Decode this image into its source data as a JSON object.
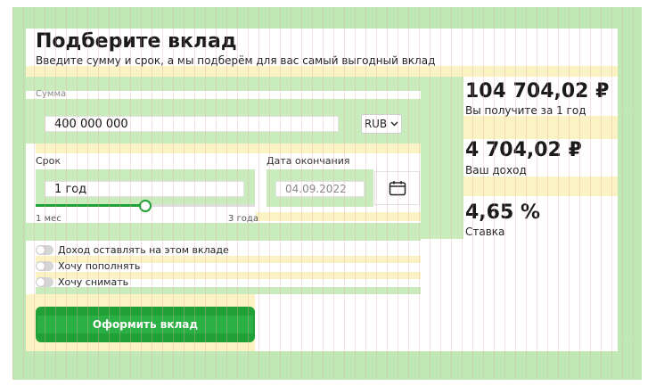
{
  "header": {
    "title": "Подберите вклад",
    "subtitle": "Введите сумму и срок, а мы подберём для вас самый выгодный вклад"
  },
  "amount": {
    "label": "Сумма",
    "value": "400 000 000",
    "currency": "RUB"
  },
  "term": {
    "label": "Срок",
    "value": "1 год",
    "slider_min_label": "1 мес",
    "slider_max_label": "3 года",
    "slider_fraction": 0.5
  },
  "end_date": {
    "label": "Дата окончания",
    "value": "04.09.2022"
  },
  "options": [
    {
      "label": "Доход оставлять на этом вкладе",
      "checked": false
    },
    {
      "label": "Хочу пополнять",
      "checked": false
    },
    {
      "label": "Хочу снимать",
      "checked": false
    }
  ],
  "submit": {
    "label": "Оформить вклад"
  },
  "results": {
    "total_value": "104 704,02 ₽",
    "total_caption": "Вы получите за 1 год",
    "income_value": "4 704,02 ₽",
    "income_caption": "Ваш доход",
    "rate_value": "4,65 %",
    "rate_caption": "Ставка"
  },
  "colors": {
    "accent": "#21a038",
    "overlay_green": "#c8ecbc",
    "overlay_yellow": "#fbf3c4"
  }
}
